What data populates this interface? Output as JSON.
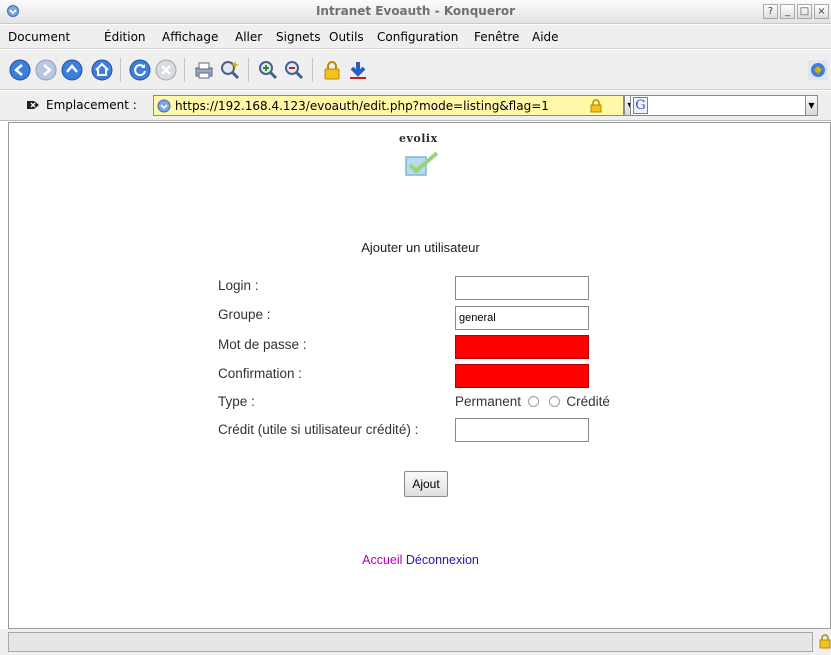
{
  "window": {
    "title": "Intranet Evoauth - Konqueror",
    "controls": [
      "?",
      "_",
      "□",
      "×"
    ]
  },
  "menu": [
    "Document",
    "Édition",
    "Affichage",
    "Aller",
    "Signets",
    "Outils",
    "Configuration",
    "Fenêtre",
    "Aide"
  ],
  "toolbar": {
    "icons": [
      "back-icon",
      "forward-icon",
      "up-icon",
      "home-icon",
      "reload-icon",
      "stop-icon",
      "print-icon",
      "find-icon",
      "zoom-in-icon",
      "zoom-out-icon",
      "security-icon",
      "download-icon"
    ]
  },
  "location": {
    "label": "Emplacement :",
    "url": "https://192.168.4.123/evoauth/edit.php?mode=listing&flag=1",
    "search_engine_glyph": "G"
  },
  "page": {
    "logo_text": "evolix",
    "form_title": "Ajouter un utilisateur",
    "fields": {
      "login_label": "Login :",
      "login_value": "",
      "group_label": "Groupe :",
      "group_value": "general",
      "password_label": "Mot de passe :",
      "confirm_label": "Confirmation :",
      "type_label": "Type :",
      "type_permanent": "Permanent",
      "type_credited": "Crédité",
      "credit_label": "Crédit (utile si utilisateur crédité) :",
      "credit_value": ""
    },
    "submit_label": "Ajout",
    "links": {
      "home": "Accueil",
      "logout": "Déconnexion"
    }
  },
  "colors": {
    "password_field_bg": "#ff0000",
    "url_bar_bg": "#fff8a8",
    "link_visited": "#b000b0",
    "link": "#1a1a9a"
  }
}
